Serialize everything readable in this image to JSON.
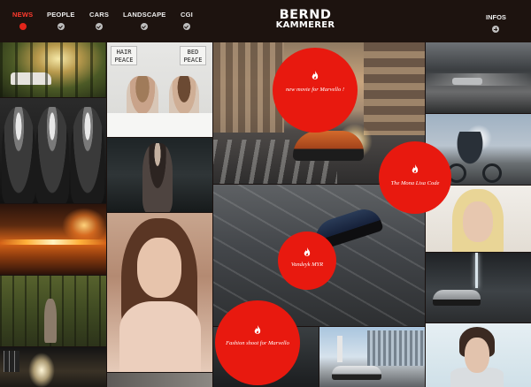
{
  "header": {
    "nav": [
      {
        "label": "NEWS",
        "active": true
      },
      {
        "label": "PEOPLE",
        "active": false
      },
      {
        "label": "CARS",
        "active": false
      },
      {
        "label": "LANDSCAPE",
        "active": false
      },
      {
        "label": "CGI",
        "active": false
      }
    ],
    "logo_line1": "BERND",
    "logo_line2": "KAMMERER",
    "infos_label": "INFOS"
  },
  "gallery": {
    "hair_peace_sign_left": "HAIR PEACE",
    "hair_peace_sign_right": "BED PEACE"
  },
  "features": [
    {
      "title": "new movie for Marvello !",
      "icon": "flame-icon"
    },
    {
      "title": "The Mona Lisa Code",
      "icon": "flame-icon"
    },
    {
      "title": "Vandeyk MYR",
      "icon": "flame-icon"
    },
    {
      "title": "Fashion shoot for Marvello",
      "icon": "flame-icon"
    }
  ],
  "colors": {
    "accent": "#e8190f",
    "header_bg": "#1d130f",
    "active_nav": "#ff3b2e"
  }
}
